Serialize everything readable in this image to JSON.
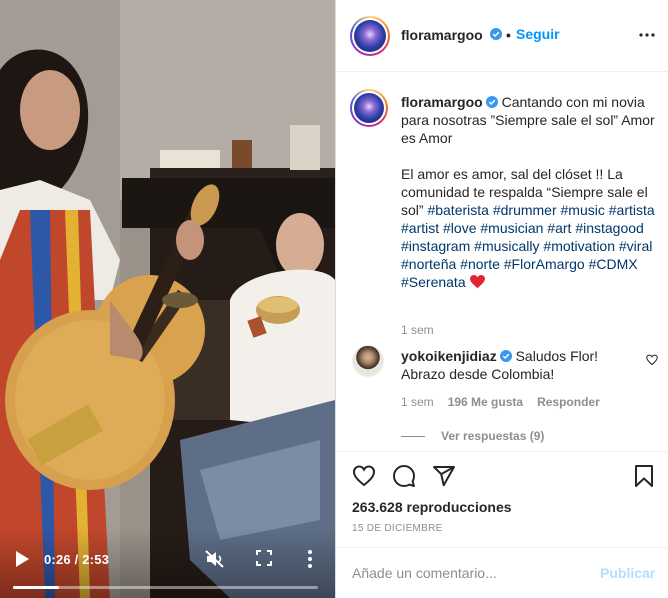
{
  "post": {
    "username": "floramargoo",
    "follow_label": "Seguir",
    "separator": "•",
    "caption_line1": "Cantando con mi novia para nosotras ”Siempre sale el sol” Amor es Amor",
    "caption_line2": "El amor es amor, sal del clóset !! La comunidad te respalda “Siempre sale el sol”",
    "hashtags": [
      "#baterista",
      "#drummer",
      "#music",
      "#artista",
      "#artist",
      "#love",
      "#musician",
      "#art",
      "#instagood",
      "#instagram",
      "#musically",
      "#motivation",
      "#viral",
      "#norteña",
      "#norte",
      "#FlorAmargo",
      "#CDMX",
      "#Serenata"
    ],
    "time_ago": "1 sem",
    "views": "263.628 reproducciones",
    "date": "15 DE DICIEMBRE"
  },
  "comment": {
    "username": "yokoikenjidiaz",
    "text": "Saludos Flor! Abrazo desde Colombia!",
    "time_ago": "1 sem",
    "likes": "196 Me gusta",
    "reply_label": "Responder",
    "view_replies": "Ver respuestas (9)"
  },
  "video": {
    "time": "0:26 / 2:53",
    "progress": 0.15
  },
  "add_comment": {
    "placeholder": "Añade un comentario...",
    "publish_label": "Publicar"
  },
  "icons": {
    "verified": "verified-badge-icon",
    "more": "more-options-icon",
    "like": "heart-icon",
    "comment": "comment-icon",
    "share": "paper-plane-icon",
    "save": "bookmark-icon",
    "play": "play-icon",
    "mute": "speaker-muted-icon",
    "fullscreen": "fullscreen-icon"
  },
  "colors": {
    "link_blue": "#0095f6",
    "hashtag": "#00376b",
    "muted_text": "#8e8e8e",
    "publish_disabled": "#b2dffc",
    "verified": "#3897f0"
  }
}
